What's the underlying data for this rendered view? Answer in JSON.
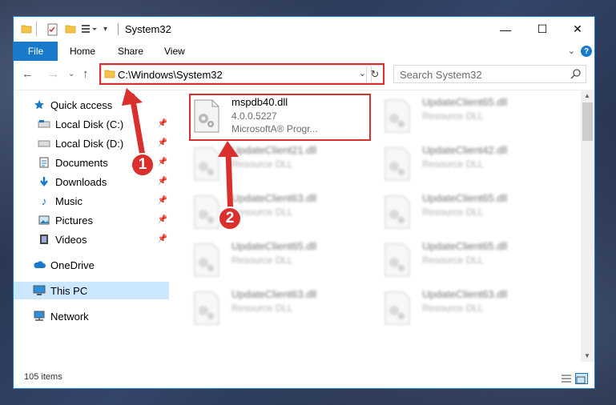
{
  "window": {
    "title": "System32",
    "tabs": {
      "file": "File",
      "home": "Home",
      "share": "Share",
      "view": "View"
    },
    "controls": {
      "minimize": "—",
      "maximize": "☐",
      "close": "✕"
    }
  },
  "address_bar": {
    "path": "C:\\Windows\\System32"
  },
  "search": {
    "placeholder": "Search System32"
  },
  "sidebar": {
    "items": [
      {
        "label": "Quick access",
        "icon": "star-icon",
        "pinned": false
      },
      {
        "label": "Local Disk (C:)",
        "icon": "drive-icon",
        "pinned": true
      },
      {
        "label": "Local Disk (D:)",
        "icon": "drive-icon",
        "pinned": true
      },
      {
        "label": "Documents",
        "icon": "documents-icon",
        "pinned": true
      },
      {
        "label": "Downloads",
        "icon": "download-icon",
        "pinned": true
      },
      {
        "label": "Music",
        "icon": "music-icon",
        "pinned": true
      },
      {
        "label": "Pictures",
        "icon": "pictures-icon",
        "pinned": true
      },
      {
        "label": "Videos",
        "icon": "videos-icon",
        "pinned": true
      },
      {
        "label": "OneDrive",
        "icon": "cloud-icon",
        "pinned": false
      },
      {
        "label": "This PC",
        "icon": "computer-icon",
        "pinned": false,
        "selected": true
      },
      {
        "label": "Network",
        "icon": "network-icon",
        "pinned": false
      }
    ]
  },
  "files": [
    {
      "name": "mspdb40.dll",
      "version": "4.0.0.5227",
      "description": "MicrosoftA® Progr...",
      "highlighted": true
    },
    {
      "name": "UpdateClient65.dll",
      "version": "",
      "description": "Resource DLL",
      "blurred": true
    },
    {
      "name": "UpdateClient21.dll",
      "version": "",
      "description": "Resource DLL",
      "blurred": true
    },
    {
      "name": "UpdateClient42.dll",
      "version": "",
      "description": "Resource DLL",
      "blurred": true
    },
    {
      "name": "UpdateClient63.dll",
      "version": "",
      "description": "Resource DLL",
      "blurred": true
    },
    {
      "name": "UpdateClient65.dll",
      "version": "",
      "description": "Resource DLL",
      "blurred": true
    },
    {
      "name": "UpdateClient65.dll",
      "version": "",
      "description": "Resource DLL",
      "blurred": true
    },
    {
      "name": "UpdateClient65.dll",
      "version": "",
      "description": "Resource DLL",
      "blurred": true
    },
    {
      "name": "UpdateClient63.dll",
      "version": "",
      "description": "Resource DLL",
      "blurred": true
    },
    {
      "name": "UpdateClient63.dll",
      "version": "",
      "description": "Resource DLL",
      "blurred": true
    }
  ],
  "status_bar": {
    "item_count": "105 items"
  },
  "annotations": {
    "step1": "1",
    "step2": "2",
    "color": "#d9302e"
  },
  "colors": {
    "accent": "#1979ca",
    "selection": "#cce8ff",
    "highlight": "#d9302e"
  }
}
